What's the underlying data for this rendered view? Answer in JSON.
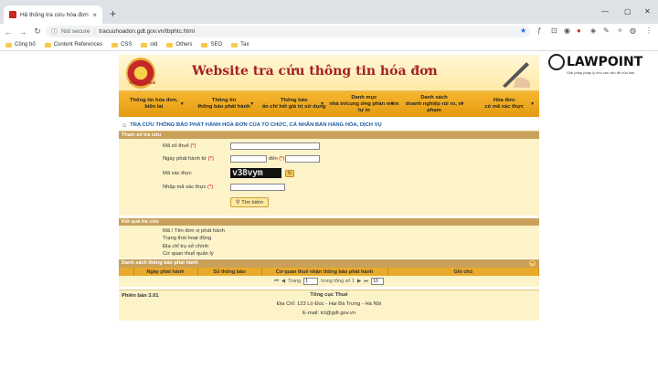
{
  "browser": {
    "tab_title": "Hệ thống tra cứu hóa đơn",
    "tab_close": "×",
    "new_tab": "+",
    "win_min": "—",
    "win_max": "▢",
    "win_close": "✕",
    "not_secure": "Not secure",
    "url": "tracuuhoadon.gdt.gov.vn/tbphtc.html",
    "bookmarks": [
      "Công bố",
      "Content References",
      "CSS",
      "old",
      "Others",
      "SEO",
      "Tax"
    ]
  },
  "site": {
    "banner_title": "Website tra cứu thông tin hóa đơn",
    "emblem_text": "TỔNG CỤC THUẾ",
    "menu": [
      {
        "line1": "Thông tin hóa đơn,",
        "line2": "biên lai"
      },
      {
        "line1": "Thông tin",
        "line2": "thông báo phát hành"
      },
      {
        "line1": "Thông báo",
        "line2": "ấn chỉ hết giá trị sử dụng"
      },
      {
        "line1": "Danh mục",
        "line2": "nhà in/cung ứng phần mềm tự in"
      },
      {
        "line1": "Danh sách",
        "line2": "doanh nghiệp rủi ro, vi phạm"
      },
      {
        "line1": "Hóa đơn",
        "line2": "có mã xác thực"
      }
    ],
    "breadcrumb": "TRA CỨU THÔNG BÁO PHÁT HÀNH HÓA ĐƠN CỦA TỔ CHỨC, CÁ NHÂN BÁN HÀNG HÓA, DỊCH VỤ",
    "search_section": "Tham số tra cứu",
    "labels": {
      "tax_code": "Mã số thuế",
      "date_from": "Ngày phát hành từ",
      "date_to": "đến",
      "captcha": "Mã xác thực",
      "captcha_input": "Nhập mã xác thực",
      "required": "(*)"
    },
    "captcha_text": "v38vym",
    "search_button": "Tìm kiếm",
    "result_section": "Kết quả tra cứu",
    "result_fields": [
      "Mã / Tên đơn vị phát hành",
      "Trạng thái hoạt động",
      "Địa chỉ trụ sở chính",
      "Cơ quan thuế quản lý"
    ],
    "list_section": "Danh sách thông báo phát hành",
    "table_headers": [
      "Ngày phát hành",
      "Số thông báo",
      "Cơ quan thuế nhận thông báo phát hành",
      "Ghi chú"
    ],
    "pager": {
      "prefix": "Trang",
      "page": "1",
      "total": "trong tổng số 1",
      "page_size": "10"
    },
    "footer": {
      "version": "Phiên bản 3.01",
      "org": "Tổng cục Thuế",
      "address": "Địa Chỉ: 123 Lò Đúc - Hai Bà Trưng - Hà Nội",
      "email": "E-mail: tct@gdt.gov.vn"
    }
  },
  "lawpoint": {
    "name": "LAWPOINT",
    "tagline": "Giải pháp pháp lý cho các vấn đề của bạn"
  }
}
